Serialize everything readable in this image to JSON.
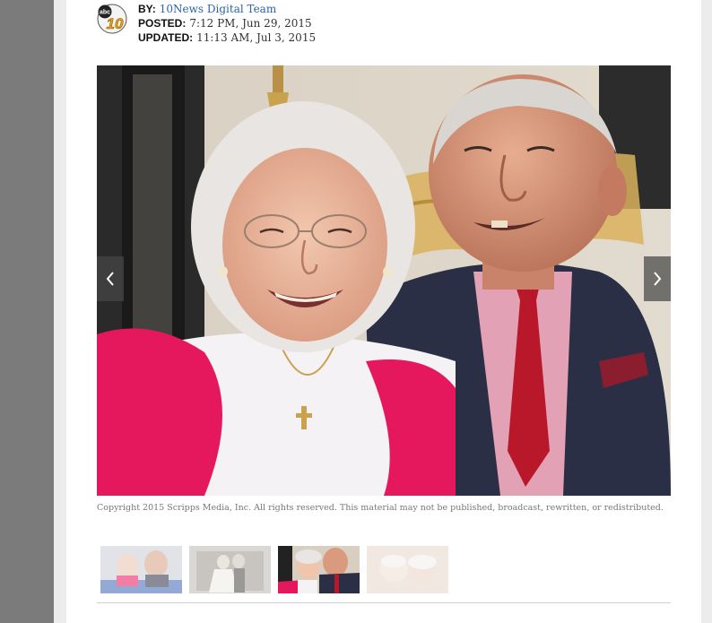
{
  "article": {
    "byline": {
      "by_label": "BY:",
      "author": "10News Digital Team",
      "posted_label": "POSTED:",
      "posted_value": "7:12 PM, Jun 29, 2015",
      "updated_label": "UPDATED:",
      "updated_value": "11:13 AM, Jul 3, 2015"
    },
    "logo": {
      "text_abc": "abc",
      "text_num": "10",
      "icon": "abc-10-logo"
    }
  },
  "gallery": {
    "caption": "Copyright 2015 Scripps Media, Inc. All rights reserved. This material may not be published, broadcast, rewritten, or redistributed.",
    "prev_icon": "chevron-left-icon",
    "next_icon": "chevron-right-icon",
    "active_index": 2,
    "thumbnails": [
      {
        "name": "thumb-1"
      },
      {
        "name": "thumb-2"
      },
      {
        "name": "thumb-3"
      },
      {
        "name": "thumb-4"
      }
    ]
  },
  "colors": {
    "left_rail": "#7b7b7b",
    "author_link": "#2a64a8"
  }
}
